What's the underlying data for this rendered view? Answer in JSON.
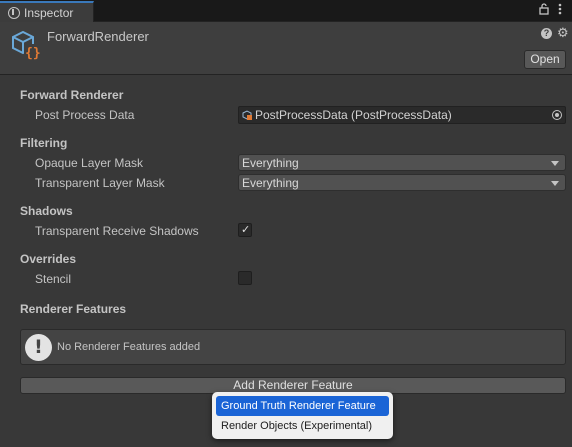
{
  "tab": {
    "title": "Inspector"
  },
  "header": {
    "object_name": "ForwardRenderer",
    "open_label": "Open"
  },
  "sections": {
    "forward_renderer": "Forward Renderer",
    "filtering": "Filtering",
    "shadows": "Shadows",
    "overrides": "Overrides",
    "renderer_features": "Renderer Features"
  },
  "fields": {
    "post_process_data": {
      "label": "Post Process Data",
      "value": "PostProcessData (PostProcessData)"
    },
    "opaque_layer_mask": {
      "label": "Opaque Layer Mask",
      "value": "Everything"
    },
    "transparent_layer_mask": {
      "label": "Transparent Layer Mask",
      "value": "Everything"
    },
    "transparent_receive_shadows": {
      "label": "Transparent Receive Shadows",
      "checked": true
    },
    "stencil": {
      "label": "Stencil",
      "checked": false
    }
  },
  "helpbox": {
    "message": "No Renderer Features added"
  },
  "add_feature_label": "Add Renderer Feature",
  "menu": {
    "items": [
      "Ground Truth Renderer Feature",
      "Render Objects (Experimental)"
    ],
    "selected_index": 0
  },
  "colors": {
    "accent": "#1a64d6",
    "tab_highlight": "#3a79bb",
    "object_icon_orange": "#e07a35",
    "object_icon_blue": "#6aa8d8"
  }
}
